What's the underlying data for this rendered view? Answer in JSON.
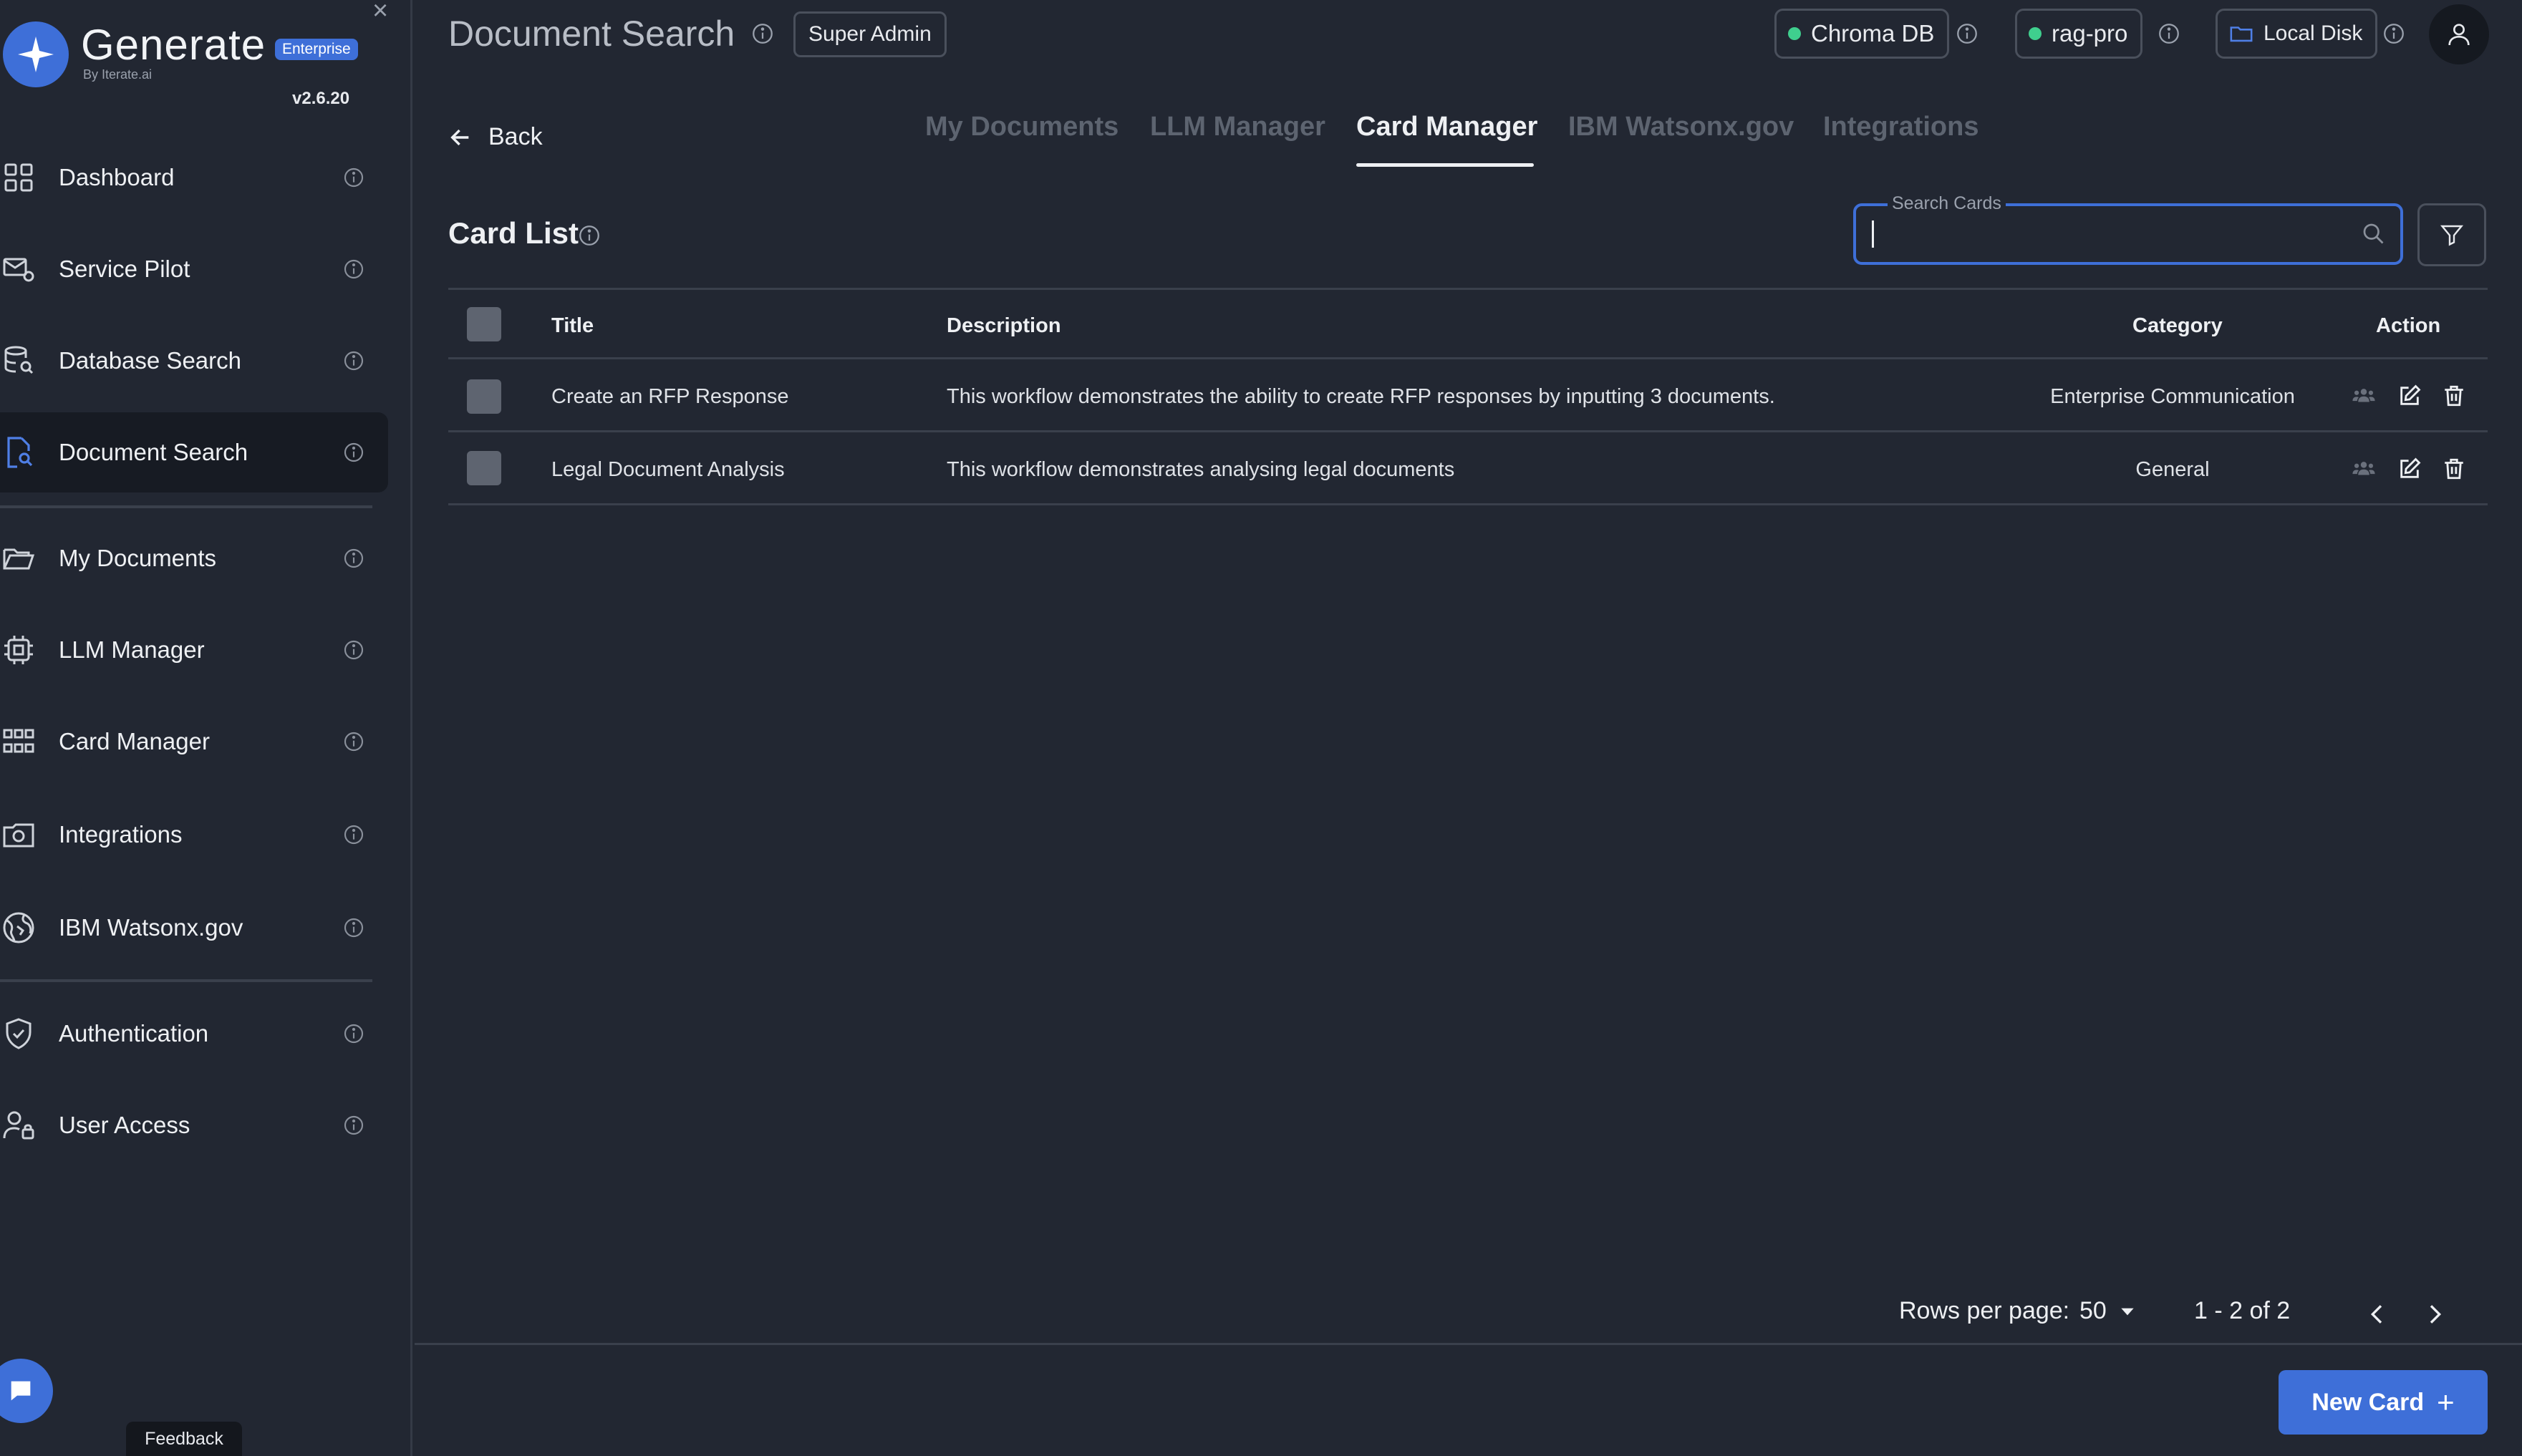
{
  "brand": {
    "name": "Generate",
    "badge": "Enterprise",
    "by": "By Iterate.ai",
    "version": "v2.6.20"
  },
  "sidebar": {
    "items": [
      {
        "label": "Dashboard",
        "icon": "grid-icon"
      },
      {
        "label": "Service Pilot",
        "icon": "service-icon"
      },
      {
        "label": "Database Search",
        "icon": "database-search-icon"
      },
      {
        "label": "Document Search",
        "icon": "document-search-icon",
        "active": true
      },
      {
        "label": "My Documents",
        "icon": "folder-open-icon"
      },
      {
        "label": "LLM Manager",
        "icon": "chip-icon"
      },
      {
        "label": "Card Manager",
        "icon": "apps-grid-icon"
      },
      {
        "label": "Integrations",
        "icon": "camera-folder-icon"
      },
      {
        "label": "IBM Watsonx.gov",
        "icon": "globe-icon"
      },
      {
        "label": "Authentication",
        "icon": "shield-check-icon"
      },
      {
        "label": "User Access",
        "icon": "user-lock-icon"
      }
    ],
    "feedback_label": "Feedback"
  },
  "header": {
    "title": "Document Search",
    "role": "Super Admin",
    "chips": [
      {
        "label": "Chroma DB",
        "status_color": "#3fcf8e"
      },
      {
        "label": "rag-pro",
        "status_color": "#3fcf8e"
      },
      {
        "label": "Local Disk",
        "icon": "folder-icon"
      }
    ]
  },
  "nav": {
    "back_label": "Back",
    "tabs": [
      {
        "label": "My Documents"
      },
      {
        "label": "LLM Manager"
      },
      {
        "label": "Card Manager",
        "active": true
      },
      {
        "label": "IBM Watsonx.gov"
      },
      {
        "label": "Integrations"
      }
    ]
  },
  "card_list": {
    "title": "Card List",
    "search": {
      "label": "Search Cards",
      "value": ""
    },
    "columns": {
      "title": "Title",
      "description": "Description",
      "category": "Category",
      "action": "Action"
    },
    "rows": [
      {
        "title": "Create an RFP Response",
        "description": "This workflow demonstrates the ability to create RFP responses by inputting 3 documents.",
        "category": "Enterprise Communication"
      },
      {
        "title": "Legal Document Analysis",
        "description": "This workflow demonstrates analysing legal documents",
        "category": "General"
      }
    ]
  },
  "pagination": {
    "rows_per_page_label": "Rows per page:",
    "rows_per_page": "50",
    "range": "1 - 2 of 2"
  },
  "actions": {
    "new_card_label": "New Card",
    "new_card_icon": "+"
  },
  "colors": {
    "accent": "#3e6fd8",
    "status_ok": "#3fcf8e",
    "background": "#222732"
  }
}
